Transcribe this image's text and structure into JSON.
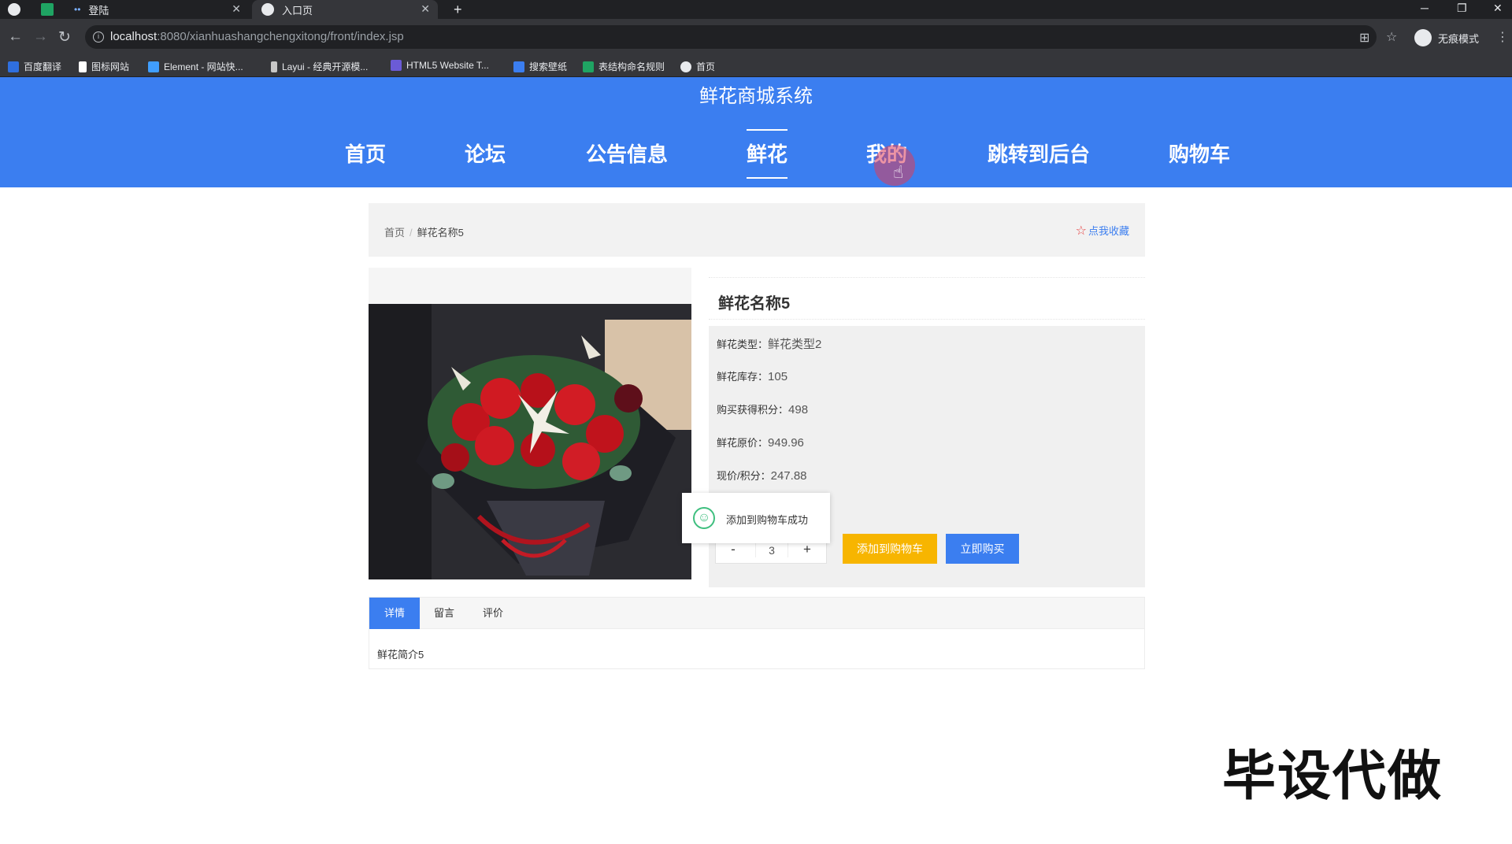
{
  "browser": {
    "tabs": [
      {
        "label": ""
      },
      {
        "label": ""
      },
      {
        "label": "登陆"
      },
      {
        "label": "入口页"
      }
    ],
    "url_host": "localhost",
    "url_rest": ":8080/xianhuashangchengxitong/front/index.jsp",
    "profile_label": "无痕模式",
    "bookmarks": [
      {
        "label": "百度翻译",
        "color": "#2f6fde"
      },
      {
        "label": "图标网站",
        "color": "#ffffff"
      },
      {
        "label": "Element - 网站快...",
        "color": "#409eff"
      },
      {
        "label": "Layui - 经典开源模...",
        "color": "#c7c7c7"
      },
      {
        "label": "HTML5 Website T...",
        "color": "#6b5bd6"
      },
      {
        "label": "搜索壁纸",
        "color": "#3b7ef0"
      },
      {
        "label": "表结构命名规则",
        "color": "#1fa463"
      },
      {
        "label": "首页",
        "color": "#e8eaed"
      }
    ]
  },
  "site": {
    "title": "鲜花商城系统",
    "nav": [
      {
        "label": "首页"
      },
      {
        "label": "论坛"
      },
      {
        "label": "公告信息"
      },
      {
        "label": "鲜花",
        "active": true
      },
      {
        "label": "我的"
      },
      {
        "label": "跳转到后台"
      },
      {
        "label": "购物车"
      }
    ],
    "accent": "#3b7ef0"
  },
  "breadcrumb": {
    "home": "首页",
    "separator": "/",
    "current": "鲜花名称5",
    "favorite": "点我收藏"
  },
  "product": {
    "name": "鲜花名称5",
    "fields": [
      {
        "label": "鲜花类型：",
        "value": "鲜花类型2"
      },
      {
        "label": "鲜花库存：",
        "value": "105"
      },
      {
        "label": "购买获得积分：",
        "value": "498"
      },
      {
        "label": "鲜花原价：",
        "value": "949.96"
      },
      {
        "label": "现价/积分：",
        "value": "247.88"
      }
    ],
    "quantity": {
      "minus": "-",
      "value": "3",
      "plus": "+"
    },
    "add_to_cart": "添加到购物车",
    "buy_now": "立即购买"
  },
  "toast": {
    "message": "添加到购物车成功"
  },
  "tabs": {
    "items": [
      {
        "label": "详情",
        "active": true
      },
      {
        "label": "留言"
      },
      {
        "label": "评价"
      }
    ],
    "content": "鲜花简介5"
  },
  "watermark": "毕设代做"
}
